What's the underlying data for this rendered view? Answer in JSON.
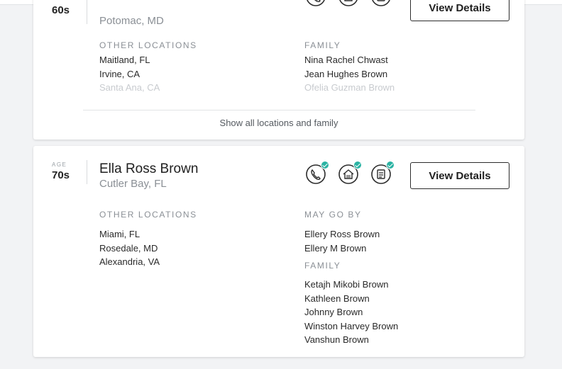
{
  "cards": [
    {
      "age_label": "",
      "age": "60s",
      "name": "",
      "location": "Potomac, MD",
      "view_details_label": "View Details",
      "other_locations": {
        "title": "OTHER LOCATIONS",
        "items": [
          "Maitland, FL",
          "Irvine, CA",
          "Santa Ana, CA"
        ]
      },
      "family": {
        "title": "FAMILY",
        "items": [
          "Nina Rachel Chwast",
          "Jean Hughes Brown",
          "Ofelia Guzman Brown"
        ]
      },
      "show_all_label": "Show all locations and family"
    },
    {
      "age_label": "AGE",
      "age": "70s",
      "name": "Ella Ross Brown",
      "location": "Cutler Bay, FL",
      "view_details_label": "View Details",
      "other_locations": {
        "title": "OTHER LOCATIONS",
        "items": [
          "Miami, FL",
          "Rosedale, MD",
          "Alexandria, VA"
        ]
      },
      "may_go_by": {
        "title": "MAY GO BY",
        "items": [
          "Ellery Ross Brown",
          "Ellery M Brown"
        ]
      },
      "family": {
        "title": "FAMILY",
        "items": [
          "Ketajh Mikobi Brown",
          "Kathleen Brown",
          "Johnny Brown",
          "Winston Harvey Brown",
          "Vanshun Brown"
        ]
      }
    }
  ],
  "icons": {
    "phone": "phone-icon",
    "address": "home-icon",
    "email": "email-icon",
    "verified": "check-badge-icon"
  },
  "colors": {
    "verified_badge": "#2bb3a3",
    "background": "#f2f3f5",
    "card": "#ffffff"
  }
}
